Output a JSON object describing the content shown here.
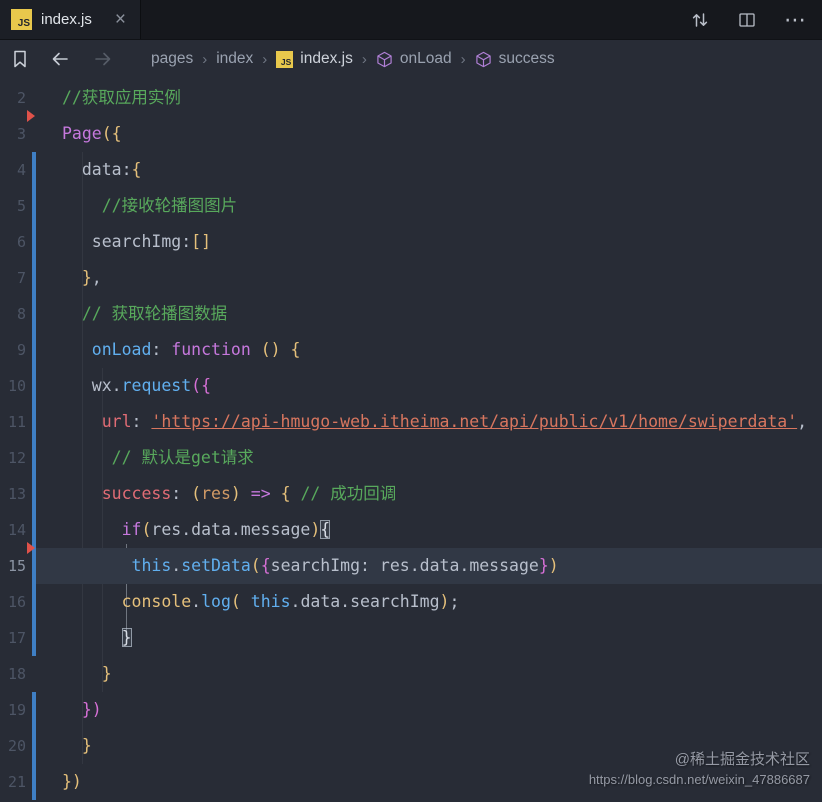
{
  "window": {
    "tab": {
      "title": "index.js",
      "close_glyph": "×",
      "js_badge": "JS"
    },
    "actions": {
      "more_glyph": "⋯"
    }
  },
  "breadcrumb": {
    "separator": "›",
    "items": [
      {
        "label": "pages",
        "icon": null,
        "bright": false
      },
      {
        "label": "index",
        "icon": null,
        "bright": false
      },
      {
        "label": "index.js",
        "icon": "js",
        "bright": true
      },
      {
        "label": "onLoad",
        "icon": "symbol",
        "bright": false
      },
      {
        "label": "success",
        "icon": "symbol",
        "bright": false
      }
    ]
  },
  "editor": {
    "palette": {
      "fg": "#b8bfcc",
      "wht": "#d8dde6",
      "com": "#58a95c",
      "mag": "#c678dd",
      "blu": "#61afef",
      "red": "#e06c75",
      "org": "#d19a66",
      "yel": "#e5c07b",
      "orc": "#d670d6",
      "url": "#d8765f",
      "gitMod": "#3f7fc4",
      "gitDel": "#e0524a"
    },
    "lines": [
      {
        "num": 2,
        "indent": 0,
        "git": null,
        "tokens": [
          {
            "t": "//获取应用实例",
            "c": "com"
          }
        ]
      },
      {
        "num": 3,
        "indent": 0,
        "git": null,
        "del": true,
        "tokens": [
          {
            "t": "Page",
            "c": "mag"
          },
          {
            "t": "({",
            "c": "yel"
          }
        ]
      },
      {
        "num": 4,
        "indent": 2,
        "git": "mod",
        "tokens": [
          {
            "t": "data:",
            "c": "fg"
          },
          {
            "t": "{",
            "c": "yel"
          }
        ]
      },
      {
        "num": 5,
        "indent": 4,
        "git": "mod",
        "tokens": [
          {
            "t": "//接收轮播图图片",
            "c": "com"
          }
        ]
      },
      {
        "num": 6,
        "indent": 3,
        "git": "mod",
        "tokens": [
          {
            "t": "searchImg:",
            "c": "fg"
          },
          {
            "t": "[]",
            "c": "yel"
          }
        ]
      },
      {
        "num": 7,
        "indent": 2,
        "git": "mod",
        "tokens": [
          {
            "t": "}",
            "c": "yel"
          },
          {
            "t": ",",
            "c": "fg"
          }
        ]
      },
      {
        "num": 8,
        "indent": 2,
        "git": "mod",
        "tokens": [
          {
            "t": "// 获取轮播图数据",
            "c": "com"
          }
        ]
      },
      {
        "num": 9,
        "indent": 3,
        "git": "mod",
        "tokens": [
          {
            "t": "onLoad",
            "c": "blu"
          },
          {
            "t": ": ",
            "c": "fg"
          },
          {
            "t": "function",
            "c": "mag"
          },
          {
            "t": " ",
            "c": "fg"
          },
          {
            "t": "()",
            "c": "yel"
          },
          {
            "t": " ",
            "c": "fg"
          },
          {
            "t": "{",
            "c": "yel"
          }
        ]
      },
      {
        "num": 10,
        "indent": 3,
        "git": "mod",
        "tokens": [
          {
            "t": "wx.",
            "c": "fg"
          },
          {
            "t": "request",
            "c": "blu"
          },
          {
            "t": "({",
            "c": "orc"
          }
        ]
      },
      {
        "num": 11,
        "indent": 4,
        "git": "mod",
        "tokens": [
          {
            "t": "url",
            "c": "red"
          },
          {
            "t": ": ",
            "c": "fg"
          },
          {
            "t": "'https://api-hmugo-web.itheima.net/api/public/v1/home/swiperdata'",
            "c": "url",
            "u": true
          },
          {
            "t": ",",
            "c": "fg"
          }
        ]
      },
      {
        "num": 12,
        "indent": 5,
        "git": "mod",
        "tokens": [
          {
            "t": "// 默认是get请求",
            "c": "com"
          }
        ]
      },
      {
        "num": 13,
        "indent": 4,
        "git": "mod",
        "tokens": [
          {
            "t": "success",
            "c": "red"
          },
          {
            "t": ": ",
            "c": "fg"
          },
          {
            "t": "(",
            "c": "yel"
          },
          {
            "t": "res",
            "c": "org"
          },
          {
            "t": ")",
            "c": "yel"
          },
          {
            "t": " ",
            "c": "fg"
          },
          {
            "t": "=>",
            "c": "mag"
          },
          {
            "t": " ",
            "c": "fg"
          },
          {
            "t": "{",
            "c": "yel"
          },
          {
            "t": " ",
            "c": "fg"
          },
          {
            "t": "// 成功回调",
            "c": "com"
          }
        ]
      },
      {
        "num": 14,
        "indent": 6,
        "git": "mod",
        "tokens": [
          {
            "t": "if",
            "c": "mag"
          },
          {
            "t": "(",
            "c": "yel"
          },
          {
            "t": "res.data.message",
            "c": "fg"
          },
          {
            "t": ")",
            "c": "yel"
          },
          {
            "t": "{",
            "c": "wht",
            "m": true
          }
        ]
      },
      {
        "num": 15,
        "indent": 7,
        "git": "mod",
        "del": true,
        "active": true,
        "tokens": [
          {
            "t": "this",
            "c": "blu"
          },
          {
            "t": ".",
            "c": "fg"
          },
          {
            "t": "setData",
            "c": "blu"
          },
          {
            "t": "(",
            "c": "yel"
          },
          {
            "t": "{",
            "c": "orc"
          },
          {
            "t": "searchImg: res.data.message",
            "c": "fg"
          },
          {
            "t": "}",
            "c": "orc"
          },
          {
            "t": ")",
            "c": "yel"
          }
        ]
      },
      {
        "num": 16,
        "indent": 6,
        "git": "mod",
        "tokens": [
          {
            "t": "console",
            "c": "yel"
          },
          {
            "t": ".",
            "c": "fg"
          },
          {
            "t": "log",
            "c": "blu"
          },
          {
            "t": "(",
            "c": "yel"
          },
          {
            "t": " ",
            "c": "fg"
          },
          {
            "t": "this",
            "c": "blu"
          },
          {
            "t": ".data.searchImg",
            "c": "fg"
          },
          {
            "t": ")",
            "c": "yel"
          },
          {
            "t": ";",
            "c": "fg"
          }
        ]
      },
      {
        "num": 17,
        "indent": 6,
        "git": "mod",
        "tokens": [
          {
            "t": "}",
            "c": "wht",
            "m": true
          }
        ]
      },
      {
        "num": 18,
        "indent": 4,
        "git": null,
        "tokens": [
          {
            "t": "}",
            "c": "yel"
          }
        ]
      },
      {
        "num": 19,
        "indent": 2,
        "git": "mod",
        "tokens": [
          {
            "t": "})",
            "c": "orc"
          }
        ]
      },
      {
        "num": 20,
        "indent": 2,
        "git": "mod",
        "tokens": [
          {
            "t": "}",
            "c": "yel"
          }
        ]
      },
      {
        "num": 21,
        "indent": 0,
        "git": "mod",
        "tokens": [
          {
            "t": "})",
            "c": "yel"
          }
        ]
      }
    ]
  },
  "watermark": {
    "line1": "@稀土掘金技术社区",
    "line2": "https://blog.csdn.net/weixin_47886687"
  }
}
